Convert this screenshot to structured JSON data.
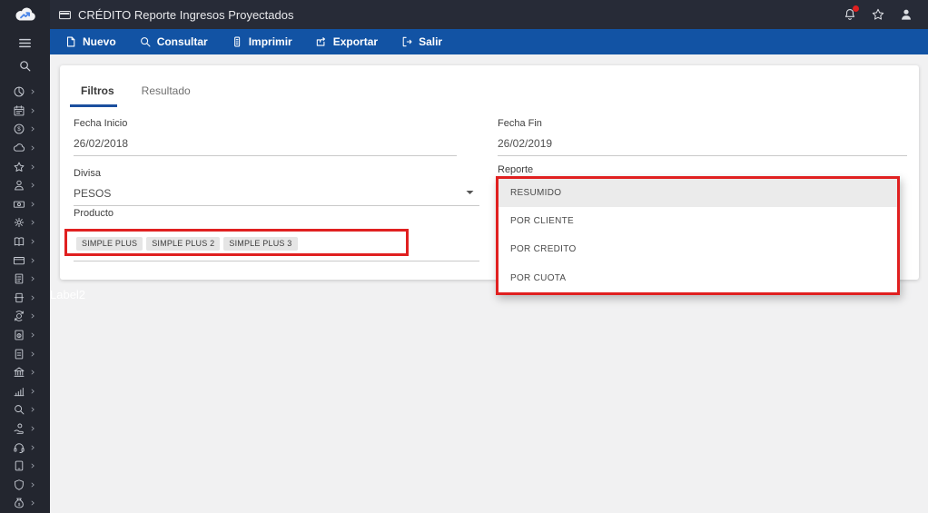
{
  "colors": {
    "toolbar_blue": "#1253a4",
    "topbar_dark": "#272b37",
    "sidebar_dark": "#23262f",
    "highlight_red": "#e02020",
    "tab_accent": "#1b4f9e",
    "chip_bg": "#e5e5e5",
    "dropdown_highlight_bg": "#ebebeb"
  },
  "topbar": {
    "title": "CRÉDITO Reporte Ingresos Proyectados",
    "title_icon": "credit-card-panel",
    "right_icons": [
      {
        "name": "notifications",
        "icon": "bell",
        "badge": true
      },
      {
        "name": "favorites",
        "icon": "star",
        "badge": false
      },
      {
        "name": "user",
        "icon": "user",
        "badge": false
      }
    ]
  },
  "toolbar": {
    "buttons": [
      {
        "label": "Nuevo",
        "icon": "new-document"
      },
      {
        "label": "Consultar",
        "icon": "search"
      },
      {
        "label": "Imprimir",
        "icon": "print"
      },
      {
        "label": "Exportar",
        "icon": "export"
      },
      {
        "label": "Salir",
        "icon": "exit"
      }
    ]
  },
  "sidebar": {
    "menu_icon": "menu",
    "search_icon": "search",
    "items": [
      {
        "icon": "pie-chart"
      },
      {
        "icon": "calendar"
      },
      {
        "icon": "coin-dollar"
      },
      {
        "icon": "cloud"
      },
      {
        "icon": "star"
      },
      {
        "icon": "person"
      },
      {
        "icon": "banknote"
      },
      {
        "icon": "gear"
      },
      {
        "icon": "book"
      },
      {
        "icon": "credit-card"
      },
      {
        "icon": "document-checklist"
      },
      {
        "icon": "printer"
      },
      {
        "icon": "currency-exchange"
      },
      {
        "icon": "invoice-dollar"
      },
      {
        "icon": "document"
      },
      {
        "icon": "bank"
      },
      {
        "icon": "bar-chart"
      },
      {
        "icon": "search"
      },
      {
        "icon": "hand-coin"
      },
      {
        "icon": "headset"
      },
      {
        "icon": "tablet"
      },
      {
        "icon": "shield"
      },
      {
        "icon": "money-bag"
      }
    ]
  },
  "tabs": [
    {
      "label": "Filtros",
      "active": true
    },
    {
      "label": "Resultado",
      "active": false
    }
  ],
  "form": {
    "fecha_inicio": {
      "label": "Fecha Inicio",
      "value": "26/02/2018"
    },
    "fecha_fin": {
      "label": "Fecha Fin",
      "value": "26/02/2019"
    },
    "divisa": {
      "label": "Divisa",
      "value": "PESOS"
    },
    "reporte": {
      "label": "Reporte",
      "options": [
        "RESUMIDO",
        "POR CLIENTE",
        "POR CREDITO",
        "POR CUOTA"
      ],
      "highlighted_option": "RESUMIDO"
    },
    "producto": {
      "label": "Producto",
      "chips": [
        "SIMPLE PLUS",
        "SIMPLE PLUS 2",
        "SIMPLE PLUS 3"
      ]
    }
  },
  "overlay_label": "Label2"
}
